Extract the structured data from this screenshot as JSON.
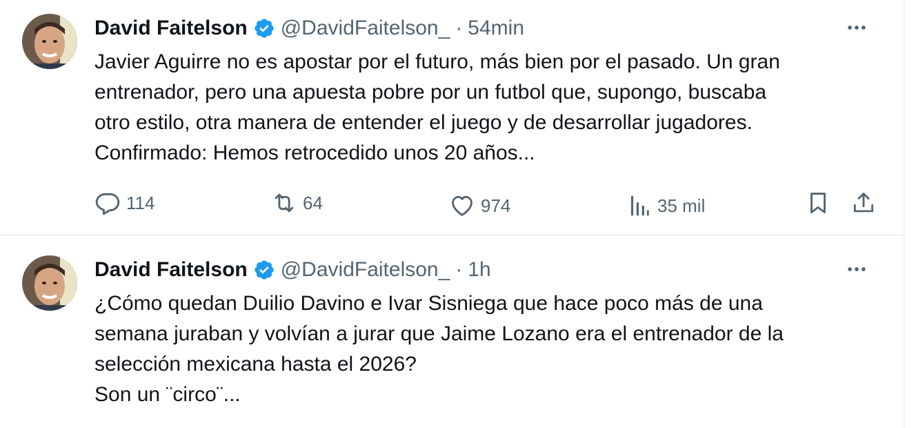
{
  "tweets": [
    {
      "author": "David Faitelson",
      "handle": "@DavidFaitelson_",
      "separator": "·",
      "time": "54min",
      "text": "Javier Aguirre no es apostar por el futuro, más bien por el pasado. Un gran\nentrenador, pero una apuesta pobre por un futbol que, supongo, buscaba\notro estilo, otra manera de entender el juego y de desarrollar jugadores.\nConfirmado: Hemos retrocedido unos 20 años...",
      "replies": "114",
      "reposts": "64",
      "likes": "974",
      "views": "35 mil"
    },
    {
      "author": "David Faitelson",
      "handle": "@DavidFaitelson_",
      "separator": "·",
      "time": "1h",
      "text": "¿Cómo quedan Duilio Davino e Ivar Sisniega que hace poco más de una\nsemana juraban y volvían a jurar que Jaime Lozano era el entrenador de la\nselección mexicana hasta el 2026?\nSon un ¨circo¨..."
    }
  ],
  "icons": {
    "verified": "verified-badge-icon",
    "more": "more-dots-icon",
    "reply": "reply-bubble-icon",
    "repost": "repost-arrows-icon",
    "like": "heart-icon",
    "views": "views-bars-icon",
    "bookmark": "bookmark-icon",
    "share": "share-upload-icon"
  },
  "colors": {
    "verified": "#1d9bf0",
    "secondary_text": "#536471",
    "primary_text": "#0f1419",
    "divider": "#eff3f4"
  }
}
